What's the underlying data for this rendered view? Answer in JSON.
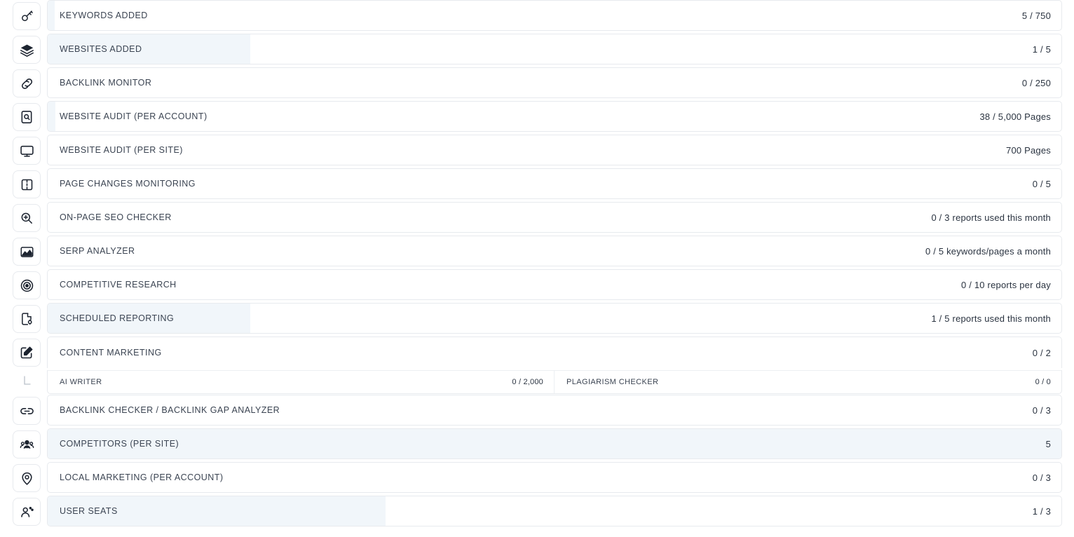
{
  "colors": {
    "fill": "#f1f6fa",
    "border": "#e7eaee",
    "text": "#3b4452",
    "value_text": "#2a3340",
    "background": "#ffffff"
  },
  "rows": [
    {
      "icon": "key-icon",
      "label": "KEYWORDS ADDED",
      "value": "5 / 750",
      "fill_percent": 0.7
    },
    {
      "icon": "layers-icon",
      "label": "WEBSITES ADDED",
      "value": "1 / 5",
      "fill_percent": 20
    },
    {
      "icon": "link-chain-icon",
      "label": "BACKLINK MONITOR",
      "value": "0 / 250",
      "fill_percent": 0
    },
    {
      "icon": "document-search-icon",
      "label": "WEBSITE AUDIT (PER ACCOUNT)",
      "value": "38 / 5,000 Pages",
      "fill_percent": 0.76
    },
    {
      "icon": "monitor-icon",
      "label": "WEBSITE AUDIT (PER SITE)",
      "value": "700 Pages",
      "fill_percent": 0
    },
    {
      "icon": "columns-icon",
      "label": "PAGE CHANGES MONITORING",
      "value": "0 / 5",
      "fill_percent": 0
    },
    {
      "icon": "magnifier-plus-icon",
      "label": "ON-PAGE SEO CHECKER",
      "value": "0 / 3 reports used this month",
      "fill_percent": 0
    },
    {
      "icon": "area-chart-icon",
      "label": "SERP ANALYZER",
      "value": "0 / 5 keywords/pages a month",
      "fill_percent": 0
    },
    {
      "icon": "target-icon",
      "label": "COMPETITIVE RESEARCH",
      "value": "0 / 10 reports per day",
      "fill_percent": 0
    },
    {
      "icon": "document-gear-icon",
      "label": "SCHEDULED REPORTING",
      "value": "1 / 5 reports used this month",
      "fill_percent": 20
    },
    {
      "icon": "edit-square-icon",
      "label": "CONTENT MARKETING",
      "value": "0 / 2",
      "fill_percent": 0,
      "sub_rows": [
        {
          "label": "AI WRITER",
          "value": "0 / 2,000",
          "fill_percent": 0
        },
        {
          "label": "PLAGIARISM CHECKER",
          "value": "0 / 0",
          "fill_percent": 0
        }
      ]
    },
    {
      "icon": "link-horizontal-icon",
      "label": "BACKLINK CHECKER / BACKLINK GAP ANALYZER",
      "value": "0 / 3",
      "fill_percent": 0
    },
    {
      "icon": "users-group-icon",
      "label": "COMPETITORS (PER SITE)",
      "value": "5",
      "fill_percent": 100
    },
    {
      "icon": "location-pin-icon",
      "label": "LOCAL MARKETING (PER ACCOUNT)",
      "value": "0 / 3",
      "fill_percent": 0
    },
    {
      "icon": "user-seat-icon",
      "label": "USER SEATS",
      "value": "1 / 3",
      "fill_percent": 33.3
    }
  ]
}
